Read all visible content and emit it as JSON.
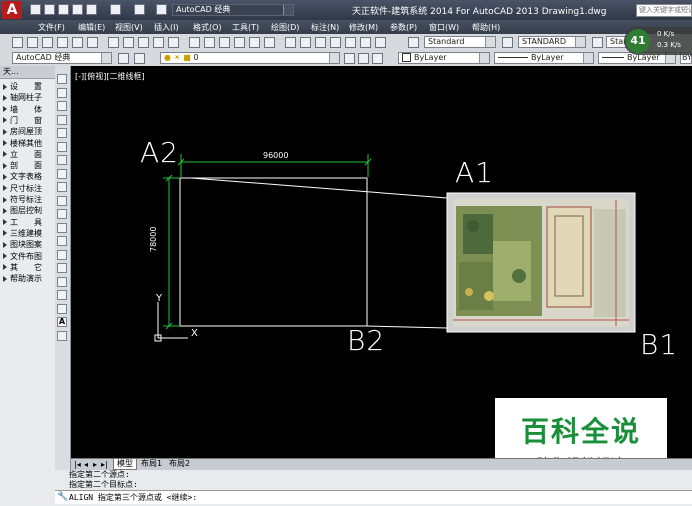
{
  "app": {
    "title": "天正软件-建筑系统 2014  For AutoCAD 2013     Drawing1.dwg",
    "workspace": "AutoCAD 经典",
    "search_placeholder": "键入关键字或短语"
  },
  "menu": [
    "文件(F)",
    "编辑(E)",
    "视图(V)",
    "插入(I)",
    "格式(O)",
    "工具(T)",
    "绘图(D)",
    "标注(N)",
    "修改(M)",
    "参数(P)",
    "窗口(W)",
    "帮助(H)"
  ],
  "toolbar": {
    "text_style": "Standard",
    "dim_style": "STANDARD",
    "table_style": "Stan",
    "layer": "0",
    "color": "ByLayer",
    "linetype": "ByLayer",
    "lineweight": "ByLayer",
    "plot": "BYC"
  },
  "overlay": {
    "badge": "41",
    "speed_up": "0 K/s",
    "speed_down": "0.3 K/s"
  },
  "viewport_label": "[-][俯视][二维线框]",
  "panel": {
    "title": "天...",
    "items": [
      "设　　置",
      "轴网柱子",
      "墙　　体",
      "门　　窗",
      "房间屋顶",
      "楼梯其他",
      "立　　面",
      "剖　　面",
      "文字表格",
      "尺寸标注",
      "符号标注",
      "图层控制",
      "工　　具",
      "三维建模",
      "图块图案",
      "文件布图",
      "其　　它",
      "帮助演示"
    ]
  },
  "drawing": {
    "label_a2": "A2",
    "label_a1": "A1",
    "label_b2": "B2",
    "label_b1": "B1",
    "dim_horizontal": "96000",
    "dim_vertical": "78000",
    "axis_y": "Y",
    "axis_x": "X"
  },
  "tabs": [
    "模型",
    "布局1",
    "布局2"
  ],
  "command": {
    "line1": "指定第二个源点:",
    "line2": "指定第二个目标点:",
    "prompt": "ALIGN 指定第三个源点或 <继续>:"
  },
  "watermark": {
    "title": "百科全说",
    "subtitle": "助你轻松解决"
  },
  "colors": {
    "canvas": "#000000",
    "dimension": "#22c33a",
    "lines": "#ffffff",
    "watermark": "#1a8f3a",
    "accent": "#d32020"
  }
}
